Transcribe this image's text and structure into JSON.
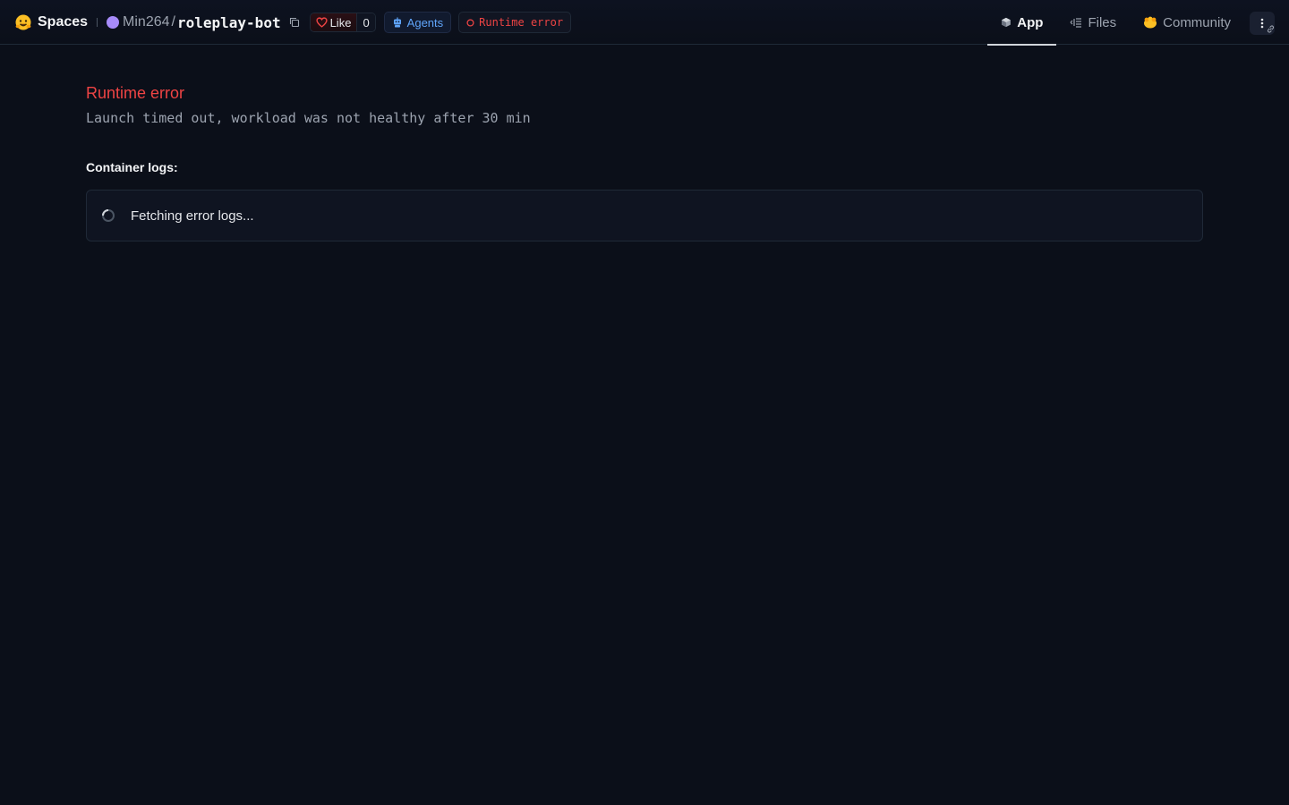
{
  "header": {
    "spaces_label": "Spaces",
    "owner": "Min264",
    "separator": "/",
    "repo": "roleplay-bot",
    "like_label": "Like",
    "like_count": "0",
    "agents_label": "Agents",
    "status_label": "Runtime error",
    "tabs": [
      {
        "label": "App",
        "icon": "cube-icon",
        "active": true
      },
      {
        "label": "Files",
        "icon": "files-icon",
        "active": false
      },
      {
        "label": "Community",
        "icon": "community-icon",
        "active": false
      }
    ]
  },
  "main": {
    "error_title": "Runtime error",
    "error_message": "Launch timed out, workload was not healthy after 30 min",
    "logs_label": "Container logs:",
    "logs_status": "Fetching error logs..."
  },
  "colors": {
    "background": "#0b0f19",
    "error": "#ef4444",
    "accent": "#60a5fa",
    "avatar": "#a78bfa"
  }
}
